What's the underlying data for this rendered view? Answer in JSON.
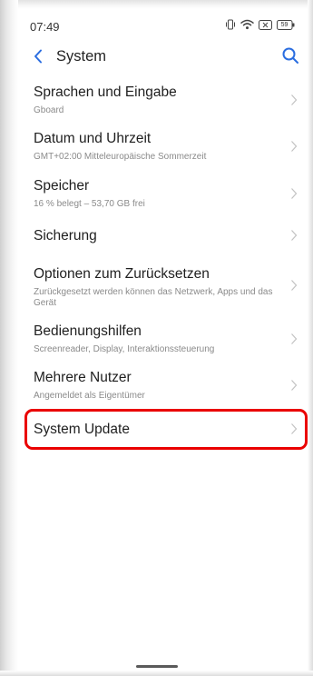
{
  "status_bar": {
    "time": "07:49",
    "battery": "59"
  },
  "header": {
    "title": "System"
  },
  "colors": {
    "accent": "#2a6de0",
    "highlight": "#ea0000"
  },
  "settings": [
    {
      "title": "Sprachen und Eingabe",
      "subtitle": "Gboard"
    },
    {
      "title": "Datum und Uhrzeit",
      "subtitle": "GMT+02:00 Mitteleuropäische Sommerzeit"
    },
    {
      "title": "Speicher",
      "subtitle": "16 % belegt – 53,70 GB frei"
    },
    {
      "title": "Sicherung",
      "subtitle": ""
    },
    {
      "title": "Optionen zum Zurücksetzen",
      "subtitle": "Zurückgesetzt werden können das Netzwerk, Apps und das Gerät"
    },
    {
      "title": "Bedienungshilfen",
      "subtitle": "Screenreader, Display, Interaktionssteuerung"
    },
    {
      "title": "Mehrere Nutzer",
      "subtitle": "Angemeldet als Eigentümer"
    },
    {
      "title": "System Update",
      "subtitle": ""
    }
  ]
}
